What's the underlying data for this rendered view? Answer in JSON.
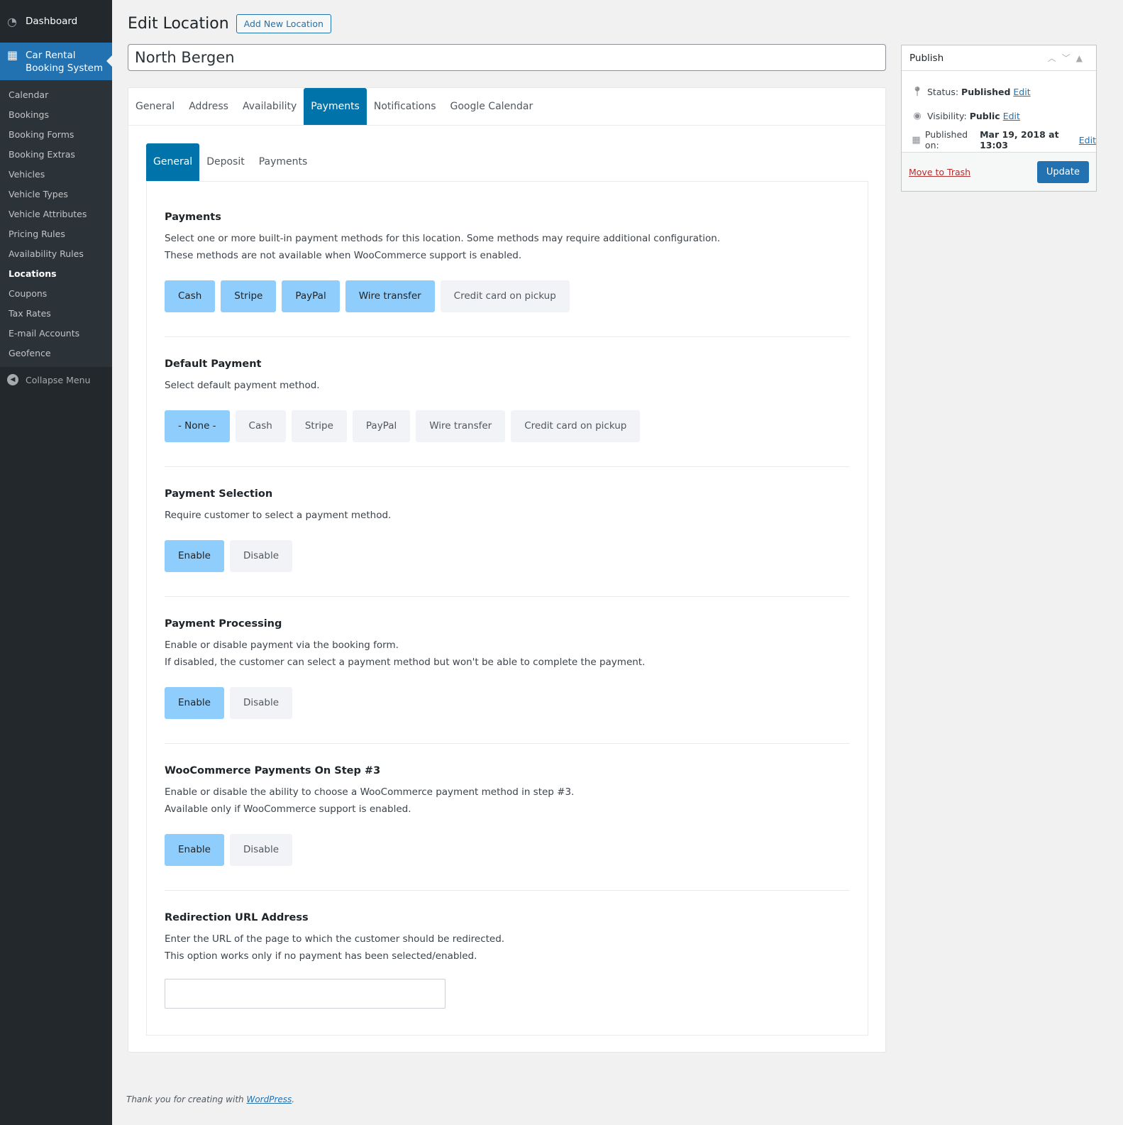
{
  "sidebar": {
    "dashboard": "Dashboard",
    "plugin": "Car Rental Booking System",
    "items": [
      "Calendar",
      "Bookings",
      "Booking Forms",
      "Booking Extras",
      "Vehicles",
      "Vehicle Types",
      "Vehicle Attributes",
      "Pricing Rules",
      "Availability Rules",
      "Locations",
      "Coupons",
      "Tax Rates",
      "E-mail Accounts",
      "Geofence"
    ],
    "current": "Locations",
    "collapse": "Collapse Menu"
  },
  "header": {
    "title": "Edit Location",
    "add_new": "Add New Location",
    "name_value": "North Bergen"
  },
  "tabs": [
    "General",
    "Address",
    "Availability",
    "Payments",
    "Notifications",
    "Google Calendar"
  ],
  "subtabs": [
    "General",
    "Deposit",
    "Payments"
  ],
  "sections": {
    "payments": {
      "title": "Payments",
      "desc1": "Select one or more built-in payment methods for this location. Some methods may require additional configuration.",
      "desc2": "These methods are not available when WooCommerce support is enabled.",
      "options": [
        "Cash",
        "Stripe",
        "PayPal",
        "Wire transfer",
        "Credit card on pickup"
      ]
    },
    "default_payment": {
      "title": "Default Payment",
      "desc1": "Select default payment method.",
      "options": [
        "- None -",
        "Cash",
        "Stripe",
        "PayPal",
        "Wire transfer",
        "Credit card on pickup"
      ]
    },
    "payment_selection": {
      "title": "Payment Selection",
      "desc1": "Require customer to select a payment method.",
      "options": [
        "Enable",
        "Disable"
      ]
    },
    "payment_processing": {
      "title": "Payment Processing",
      "desc1": "Enable or disable payment via the booking form.",
      "desc2": "If disabled, the customer can select a payment method but won't be able to complete the payment.",
      "options": [
        "Enable",
        "Disable"
      ]
    },
    "woocommerce": {
      "title": "WooCommerce Payments On Step #3",
      "desc1": "Enable or disable the ability to choose a WooCommerce payment method in step #3.",
      "desc2": "Available only if WooCommerce support is enabled.",
      "options": [
        "Enable",
        "Disable"
      ]
    },
    "redirection": {
      "title": "Redirection URL Address",
      "desc1": "Enter the URL of the page to which the customer should be redirected.",
      "desc2": "This option works only if no payment has been selected/enabled.",
      "value": ""
    }
  },
  "publish": {
    "title": "Publish",
    "status_label": "Status:",
    "status": "Published",
    "visibility_label": "Visibility:",
    "visibility": "Public",
    "published_label": "Published on:",
    "published": "Mar 19, 2018 at 13:03",
    "edit": "Edit",
    "trash": "Move to Trash",
    "update": "Update"
  },
  "footer": {
    "text": "Thank you for creating with ",
    "link": "WordPress",
    "end": "."
  },
  "colors": {
    "accent": "#0073aa",
    "selected": "#8fcdfd",
    "sidebar": "#23282d"
  }
}
